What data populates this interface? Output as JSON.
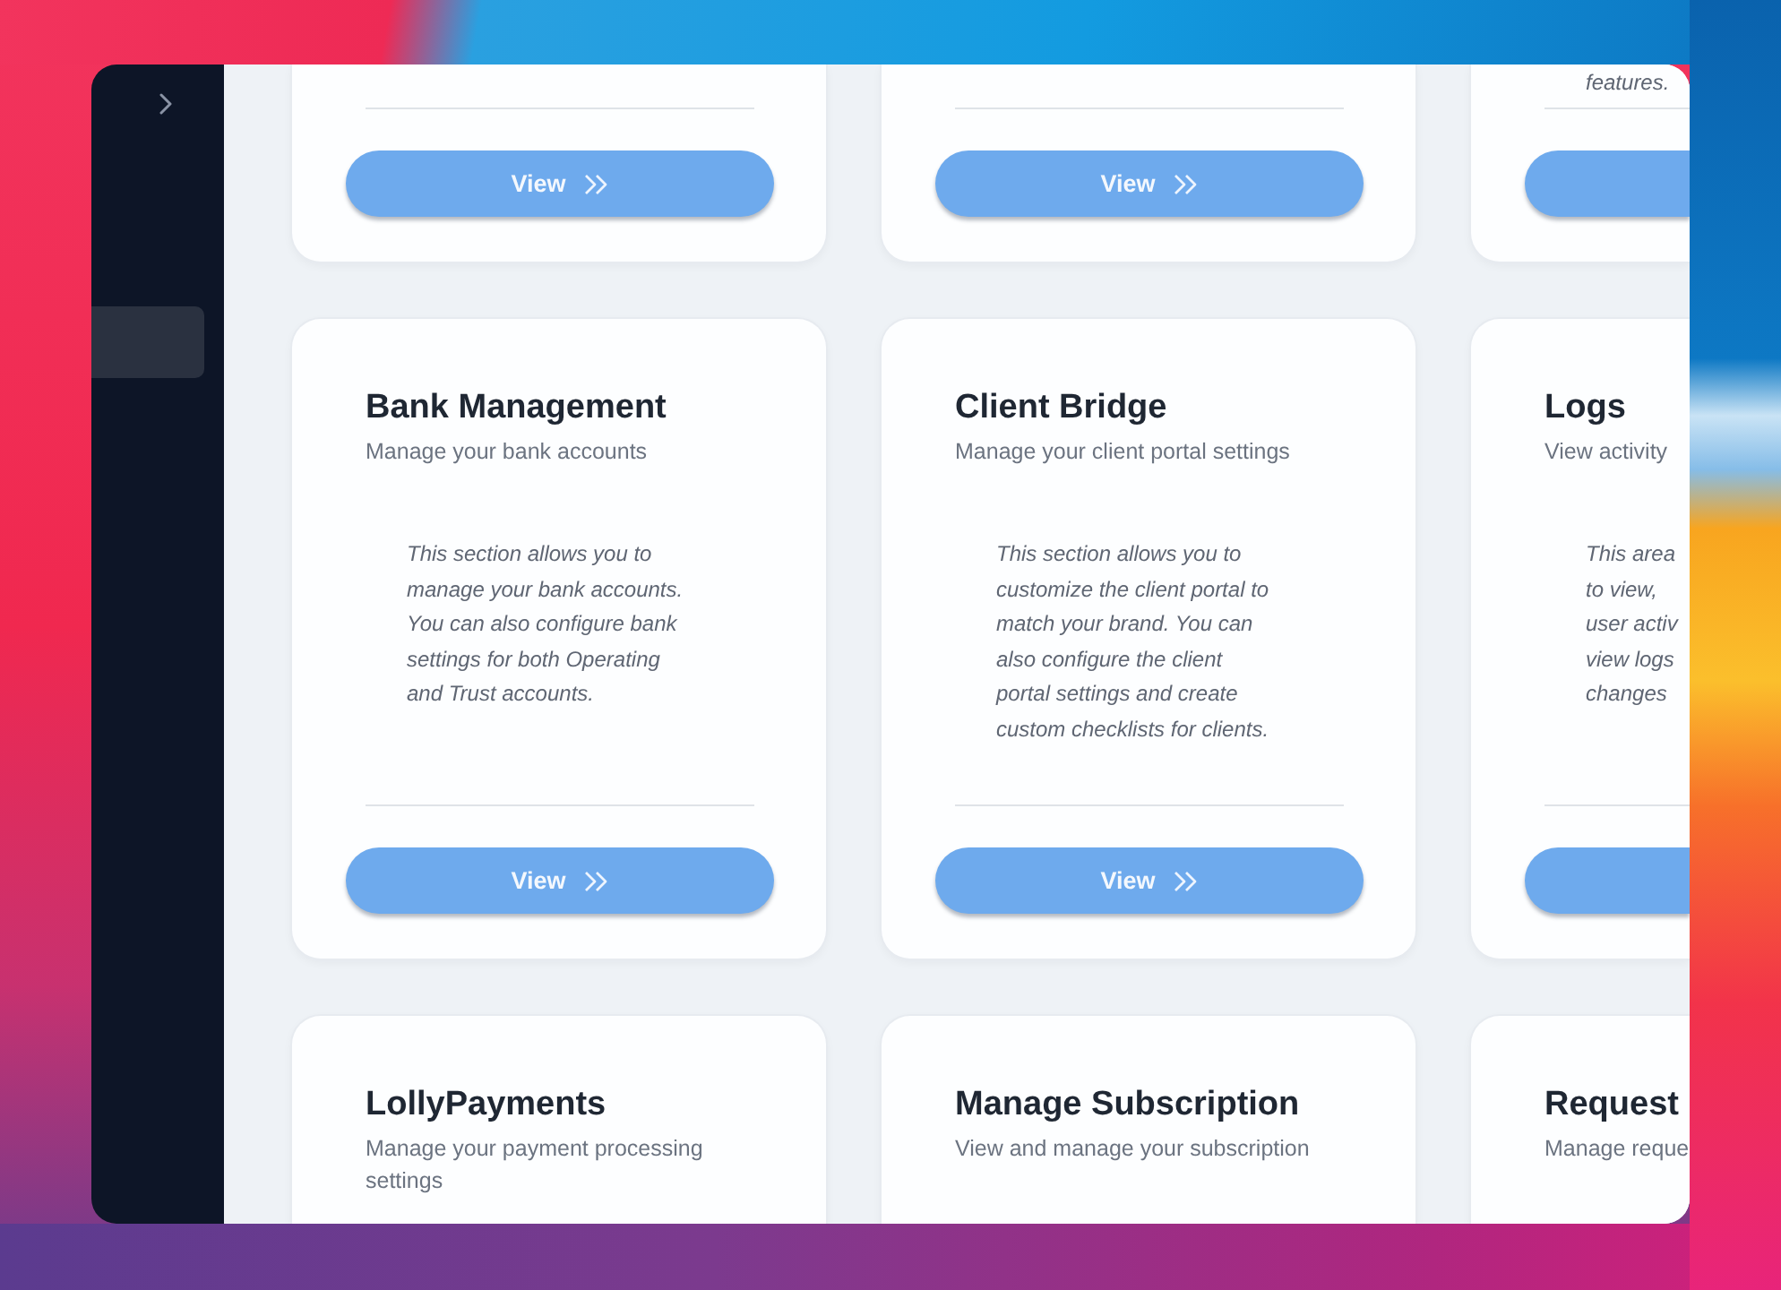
{
  "sidebar": {
    "items": [
      {
        "selected": true
      }
    ]
  },
  "rows": [
    {
      "cut_top": true,
      "cut_bottom": false,
      "cards": [
        {
          "button": {
            "label": "View",
            "cut_off": false
          }
        },
        {
          "button": {
            "label": "View",
            "cut_off": false
          }
        },
        {
          "description": [
            "features."
          ],
          "button": {
            "cut_off": true
          }
        }
      ]
    },
    {
      "cut_top": false,
      "cut_bottom": false,
      "cards": [
        {
          "title": "Bank Management",
          "subtitle": "Manage your bank accounts",
          "description": [
            "This section allows you to",
            "manage your bank accounts.",
            "You can also configure bank",
            "settings for both Operating",
            "and Trust accounts."
          ],
          "button": {
            "label": "View",
            "cut_off": false
          }
        },
        {
          "title": "Client Bridge",
          "subtitle": "Manage your client portal settings",
          "description": [
            "This section allows you to",
            "customize the client portal to",
            "match your brand. You can",
            "also configure the client",
            "portal settings and create",
            "custom checklists for clients."
          ],
          "button": {
            "label": "View",
            "cut_off": false
          }
        },
        {
          "title": "Logs",
          "subtitle": "View activity",
          "description": [
            "This area",
            "to view,",
            "user activ",
            "view logs",
            "changes"
          ],
          "button": {
            "cut_off": true
          }
        }
      ]
    },
    {
      "cut_top": false,
      "cut_bottom": true,
      "cards": [
        {
          "title": "LollyPayments",
          "subtitle": "Manage your payment processing settings"
        },
        {
          "title": "Manage Subscription",
          "subtitle": "View and manage your subscription"
        },
        {
          "title": "Request",
          "subtitle": "Manage reque"
        }
      ]
    }
  ]
}
